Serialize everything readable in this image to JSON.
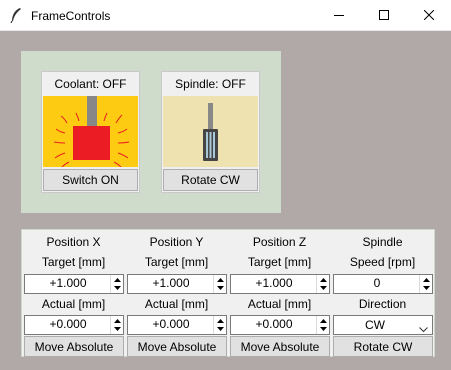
{
  "window": {
    "title": "FrameControls"
  },
  "coolant": {
    "label": "Coolant: OFF",
    "button_label": "Switch ON"
  },
  "spindle_card": {
    "label": "Spindle: OFF",
    "button_label": "Rotate CW"
  },
  "columns": [
    {
      "title": "Position X",
      "subtitle": "Target [mm]",
      "target": "+1.000",
      "actual_label": "Actual [mm]",
      "actual": "+0.000",
      "button_label": "Move Absolute"
    },
    {
      "title": "Position Y",
      "subtitle": "Target [mm]",
      "target": "+1.000",
      "actual_label": "Actual [mm]",
      "actual": "+0.000",
      "button_label": "Move Absolute"
    },
    {
      "title": "Position Z",
      "subtitle": "Target [mm]",
      "target": "+1.000",
      "actual_label": "Actual [mm]",
      "actual": "+0.000",
      "button_label": "Move Absolute"
    }
  ],
  "spindle": {
    "title": "Spindle",
    "subtitle": "Speed [rpm]",
    "speed": "0",
    "direction_label": "Direction",
    "direction": "CW",
    "button_label": "Rotate CW"
  },
  "colors": {
    "window_bg": "#b1a8a8",
    "top_frame_bg": "#cfdccc",
    "coolant_art_bg": "#fdcc12",
    "coolant_part": "#ec1c24",
    "spindle_art_bg": "#eee3b0"
  }
}
